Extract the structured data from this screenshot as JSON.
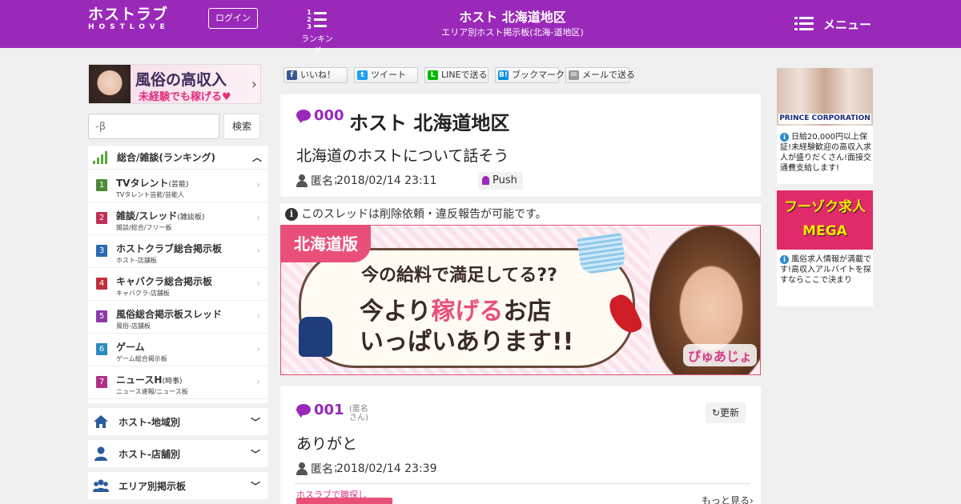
{
  "header": {
    "logo_main": "ホストラブ",
    "logo_sub": "HOSTLOVE",
    "login_label": "ログイン",
    "rank_nums": "1 2 3",
    "rank_label": "ランキング",
    "title": "ホスト 北海道地区",
    "subtitle": "エリア別ホスト掲示板(北海-道地区)",
    "menu_label": "メニュー"
  },
  "left_ad": {
    "line1": "風俗の高収入",
    "line2": "未経験でも稼げる♥"
  },
  "search": {
    "placeholder": "-β",
    "button": "検索"
  },
  "ranking": {
    "title": "総合/雑談(ランキング)",
    "items": [
      {
        "num": "1",
        "title": "TVタレント",
        "tag": "(芸能)",
        "sub": "TVタレント芸能/芸能人",
        "color": "#4e8a3a"
      },
      {
        "num": "2",
        "title": "雑談/スレッド",
        "tag": "(雑談板)",
        "sub": "雑談/総合/フリー板",
        "color": "#c03058"
      },
      {
        "num": "3",
        "title": "ホストクラブ総合掲示板",
        "tag": "",
        "sub": "ホスト-店舗板",
        "color": "#2a6ab0"
      },
      {
        "num": "4",
        "title": "キャバクラ総合掲示板",
        "tag": "",
        "sub": "キャバクラ-店舗板",
        "color": "#c03038"
      },
      {
        "num": "5",
        "title": "風俗総合掲示板スレッド",
        "tag": "",
        "sub": "風俗-店舗板",
        "color": "#8a3aa8"
      },
      {
        "num": "6",
        "title": "ゲーム",
        "tag": "",
        "sub": "ゲーム総合掲示板",
        "color": "#2a8ac0"
      },
      {
        "num": "7",
        "title": "ニュースH",
        "tag": "(時事)",
        "sub": "ニュース速報/ニュース板",
        "color": "#b03088"
      }
    ]
  },
  "categories": [
    {
      "label": "ホスト-地域別",
      "icon": "home-icon"
    },
    {
      "label": "ホスト-店舗別",
      "icon": "user-icon"
    },
    {
      "label": "エリア別掲示板",
      "icon": "users-icon"
    }
  ],
  "share": [
    {
      "label": "いいね！",
      "icon": "f",
      "color": "#3b5998"
    },
    {
      "label": "ツイート",
      "icon": "t",
      "color": "#1da1f2"
    },
    {
      "label": "LINEで送る",
      "icon": "L",
      "color": "#00b900"
    },
    {
      "label": "ブックマーク",
      "icon": "B!",
      "color": "#008fde"
    },
    {
      "label": "メールで送る",
      "icon": "✉",
      "color": "#999999"
    }
  ],
  "thread": {
    "num": "000",
    "title": "ホスト 北海道地区",
    "body": "北海道のホストについて話そう",
    "author": "匿名さん",
    "date": "2018/02/14 23:11",
    "push": "Push"
  },
  "notice": "このスレッドは削除依頼・違反報告が可能です。",
  "banner": {
    "tag": "北海道版",
    "line1": "今の給料で満足してる??",
    "line2a": "今より",
    "line2b": "稼げる",
    "line2c": "お店",
    "line3": "いっぱいあります!!",
    "logo": "ぴゅあじょ"
  },
  "reply": {
    "num": "001",
    "name": "(匿名さん)",
    "reload": "更新",
    "body": "ありがと",
    "author": "匿名さん",
    "date": "2018/02/14 23:39",
    "job_label": "ホスラブで職探し",
    "job_more": "もっと見る"
  },
  "right_ads": [
    {
      "brand": "PRINCE CORPORATION",
      "text": "日給20,000円以上保証!未経験歓迎の高収入求人が盛りだくさん!面接交通費支給します!"
    },
    {
      "brand": "フーゾク求人MEGA",
      "text": "風俗求人情報が満載です!高収入アルバイトを探すならここで決まり"
    }
  ]
}
